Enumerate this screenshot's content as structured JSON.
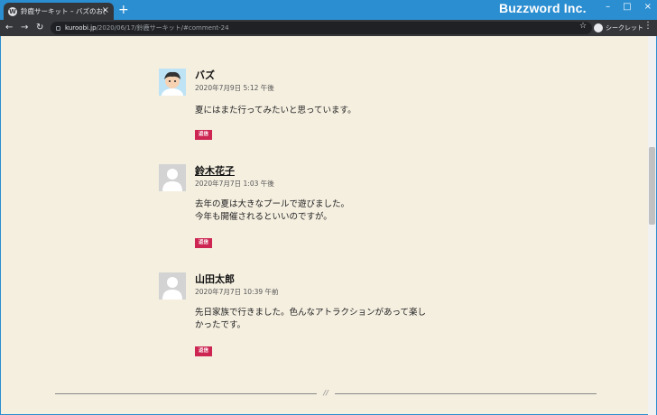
{
  "browser": {
    "tab_title": "鈴鹿サーキット – バズのお出かけブログ",
    "tab_close": "×",
    "new_tab": "+",
    "brand": "Buzzword Inc.",
    "window_buttons": [
      "–",
      "□",
      "×"
    ],
    "url_host": "kuroobi.jp",
    "url_path": "/2020/06/17/鈴鹿サーキット/#comment-24",
    "incognito_label": "シークレット"
  },
  "comments": [
    {
      "author": "バズ",
      "date": "2020年7月9日 5:12 午後",
      "lines": [
        "夏にはまた行ってみたいと思っています。"
      ],
      "reply": "返信",
      "avatar": "custom-avatar"
    },
    {
      "author": "鈴木花子",
      "date": "2020年7月7日 1:03 午後",
      "lines": [
        "去年の夏は大きなプールで遊びました。",
        "今年も開催されるといいのですが。"
      ],
      "reply": "返信",
      "avatar": "default-avatar"
    },
    {
      "author": "山田太郎",
      "date": "2020年7月7日 10:39 午前",
      "lines": [
        "先日家族で行きました。色んなアトラクションがあって楽し",
        "かったです。"
      ],
      "reply": "返信",
      "avatar": "default-avatar"
    }
  ],
  "divider_mark": "//",
  "colors": {
    "titlebar": "#2b8ed1",
    "reply_bg": "#cd2653",
    "page_bg": "#f5efe0"
  }
}
